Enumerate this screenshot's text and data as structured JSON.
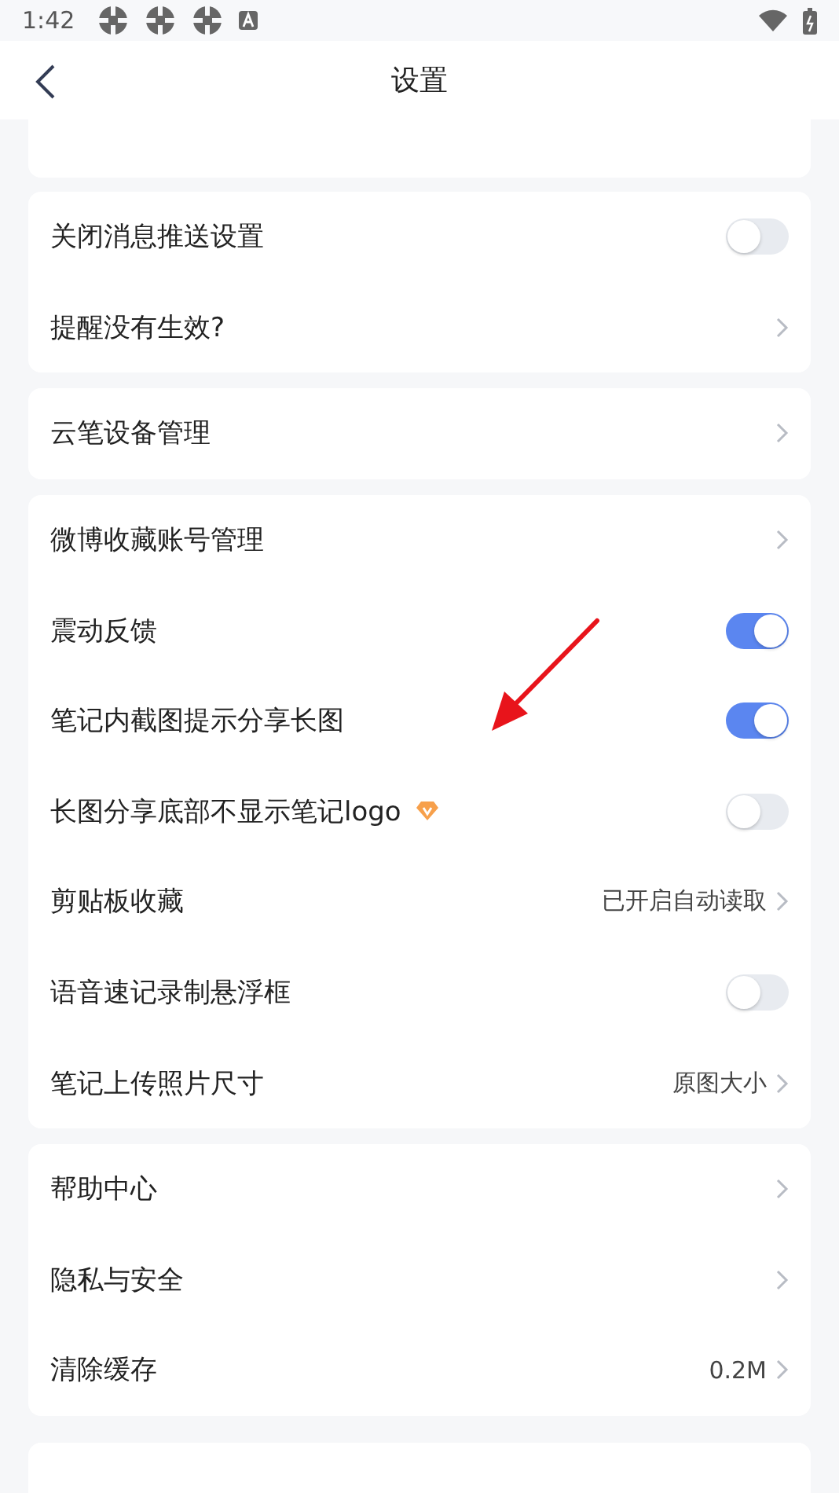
{
  "status_bar": {
    "time": "1:42"
  },
  "header": {
    "title": "设置"
  },
  "groups": [
    {
      "rows": [
        {
          "kind": "toggle",
          "label": "关闭消息推送设置",
          "on": false,
          "premium": false
        },
        {
          "kind": "link",
          "label": "提醒没有生效?",
          "premium": false
        }
      ]
    },
    {
      "rows": [
        {
          "kind": "link",
          "label": "云笔设备管理",
          "premium": false
        }
      ]
    },
    {
      "rows": [
        {
          "kind": "link",
          "label": "微博收藏账号管理",
          "premium": false
        },
        {
          "kind": "toggle",
          "label": "震动反馈",
          "on": true,
          "premium": false
        },
        {
          "kind": "toggle",
          "label": "笔记内截图提示分享长图",
          "on": true,
          "premium": false
        },
        {
          "kind": "toggle",
          "label": "长图分享底部不显示笔记logo",
          "on": false,
          "premium": true
        },
        {
          "kind": "link",
          "label": "剪贴板收藏",
          "value": "已开启自动读取",
          "premium": false
        },
        {
          "kind": "toggle",
          "label": "语音速记录制悬浮框",
          "on": false,
          "premium": false
        },
        {
          "kind": "link",
          "label": "笔记上传照片尺寸",
          "value": "原图大小",
          "premium": false
        }
      ]
    },
    {
      "rows": [
        {
          "kind": "link",
          "label": "帮助中心",
          "premium": false
        },
        {
          "kind": "link",
          "label": "隐私与安全",
          "premium": false
        },
        {
          "kind": "link",
          "label": "清除缓存",
          "value": "0.2M",
          "premium": false
        }
      ]
    }
  ]
}
